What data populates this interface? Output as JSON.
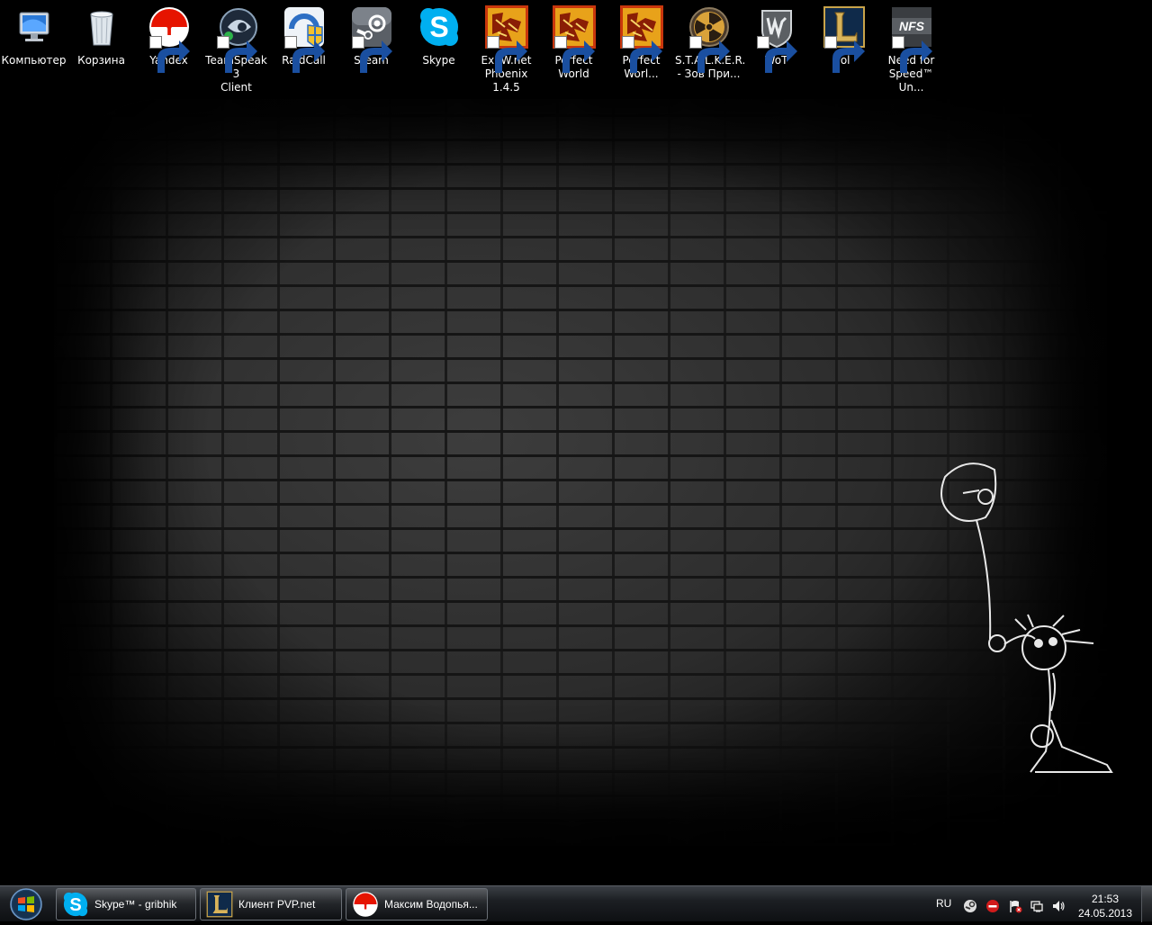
{
  "desktop": {
    "icons": [
      {
        "label": "Компьютер",
        "icon": "computer-icon"
      },
      {
        "label": "Корзина",
        "icon": "recycle-bin-icon"
      },
      {
        "label": "Yandex",
        "icon": "yandex-icon"
      },
      {
        "label": "TeamSpeak 3\nClient",
        "icon": "teamspeak-icon"
      },
      {
        "label": "RaidCall",
        "icon": "raidcall-icon"
      },
      {
        "label": "Steam",
        "icon": "steam-icon"
      },
      {
        "label": "Skype",
        "icon": "skype-icon"
      },
      {
        "label": "ExPW.net\nPhoenix 1.4.5",
        "icon": "perfect-world-icon"
      },
      {
        "label": "Perfect\nWorld",
        "icon": "perfect-world-icon"
      },
      {
        "label": "Perfect\nWorl...",
        "icon": "perfect-world-icon"
      },
      {
        "label": "S.T.A.L.K.E.R.\n- Зов При...",
        "icon": "stalker-radiation-icon"
      },
      {
        "label": "WoT",
        "icon": "world-of-tanks-icon"
      },
      {
        "label": "lol",
        "icon": "league-of-legends-icon"
      },
      {
        "label": "Need for\nSpeed™ Un...",
        "icon": "nfs-icon"
      }
    ]
  },
  "taskbar": {
    "tasks": [
      {
        "label": "Skype™ - gribhik",
        "icon": "skype-icon"
      },
      {
        "label": "Клиент PVP.net",
        "icon": "league-of-legends-icon"
      },
      {
        "label": "Максим Водопья...",
        "icon": "yandex-icon"
      }
    ],
    "language": "RU",
    "time": "21:53",
    "date": "24.05.2013"
  },
  "colors": {
    "taskbar": "#1c1f23",
    "skype": "#00aff0",
    "yandex": "#e61400",
    "desktop_bg": "#000000"
  }
}
